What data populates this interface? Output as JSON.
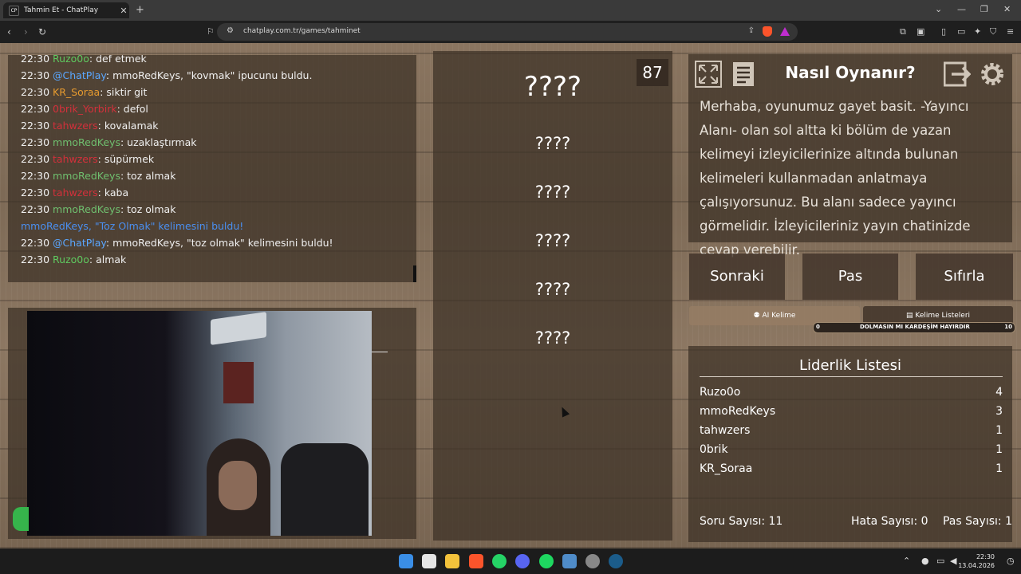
{
  "browser": {
    "tab_title": "Tahmin Et - ChatPlay",
    "tab_favicon": "CP",
    "url": "chatplay.com.tr/games/tahminet"
  },
  "chat": {
    "lines": [
      {
        "time": "22:30",
        "user": "Ruzo0o",
        "text": ": def etmek"
      },
      {
        "time": "22:30",
        "user": "@ChatPlay",
        "text": ": mmoRedKeys, \"kovmak\" ipucunu buldu."
      },
      {
        "time": "22:30",
        "user": "KR_Soraa",
        "text": ": siktir git"
      },
      {
        "time": "22:30",
        "user": "0brik_Yorbirk",
        "text": ": defol"
      },
      {
        "time": "22:30",
        "user": "tahwzers",
        "text": ": kovalamak"
      },
      {
        "time": "22:30",
        "user": "mmoRedKeys",
        "text": ": uzaklaştırmak"
      },
      {
        "time": "22:30",
        "user": "tahwzers",
        "text": ": süpürmek"
      },
      {
        "time": "22:30",
        "user": "mmoRedKeys",
        "text": ": toz almak"
      },
      {
        "time": "22:30",
        "user": "tahwzers",
        "text": ": kaba"
      },
      {
        "time": "22:30",
        "user": "mmoRedKeys",
        "text": ": toz olmak"
      },
      {
        "time": "",
        "user": "mmoRedKeys, \"Toz Olmak\" kelimesini buldu!",
        "text": ""
      },
      {
        "time": "22:30",
        "user": "@ChatPlay",
        "text": ": mmoRedKeys, \"toz olmak\" kelimesini buldu!"
      },
      {
        "time": "22:30",
        "user": "Ruzo0o",
        "text": ": almak"
      }
    ]
  },
  "game": {
    "timer": "87",
    "words": [
      "????",
      "????",
      "????",
      "????",
      "????",
      "????"
    ]
  },
  "help": {
    "title": "Nasıl Oynanır?",
    "text": "Merhaba, oyunumuz gayet basit. -Yayıncı Alanı- olan sol altta ki bölüm de yazan kelimeyi izleyicilerinize altında bulunan kelimeleri kullanmadan anlatmaya çalışıyorsunuz. Bu alanı sadece yayıncı görmelidir. İzleyicileriniz yayın chatinizde cevap verebilir."
  },
  "controls": {
    "next": "Sonraki",
    "pass": "Pas",
    "reset": "Sıfırla",
    "ai_word": "AI Kelime",
    "word_lists": "Kelime Listeleri",
    "progress_label": "DOLMASIN MI KARDEŞİM HAYIRDIR",
    "progress_min": "0",
    "progress_max": "10"
  },
  "leaderboard": {
    "title": "Liderlik Listesi",
    "rows": [
      {
        "name": "Ruzo0o",
        "score": "4"
      },
      {
        "name": "mmoRedKeys",
        "score": "3"
      },
      {
        "name": "tahwzers",
        "score": "1"
      },
      {
        "name": "0brik",
        "score": "1"
      },
      {
        "name": "KR_Soraa",
        "score": "1"
      }
    ],
    "question_count": "Soru Sayısı: 11",
    "error_count": "Hata Sayısı: 0",
    "pass_count": "Pas Sayısı: 1"
  },
  "taskbar": {
    "time": "22:30",
    "date": "13.04.2026"
  },
  "colors": {
    "chat_user_green": "#5fc95f",
    "chat_user_blue": "#5aa7ff",
    "chat_user_orange": "#e69a2f",
    "chat_user_red": "#d3303b",
    "panel_bg": "#3c3026"
  }
}
